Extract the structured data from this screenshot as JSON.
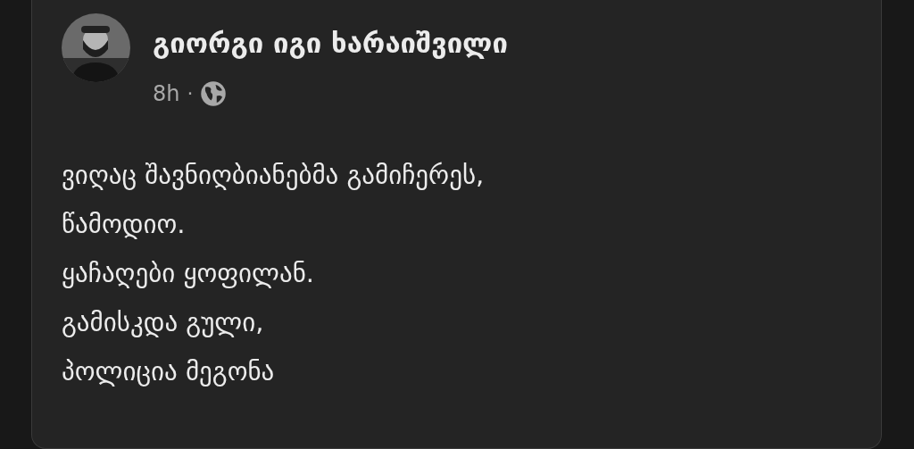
{
  "post": {
    "author": "გიორგი იგი ხარაიშვილი",
    "time": "8h",
    "separator": "·",
    "lines": [
      "ვიღაც შავნიღბიანებმა გამიჩერეს,",
      "წამოდიო.",
      "ყაჩაღები ყოფილან.",
      "გამისკდა გული,",
      "პოლიცია მეგონა"
    ]
  }
}
